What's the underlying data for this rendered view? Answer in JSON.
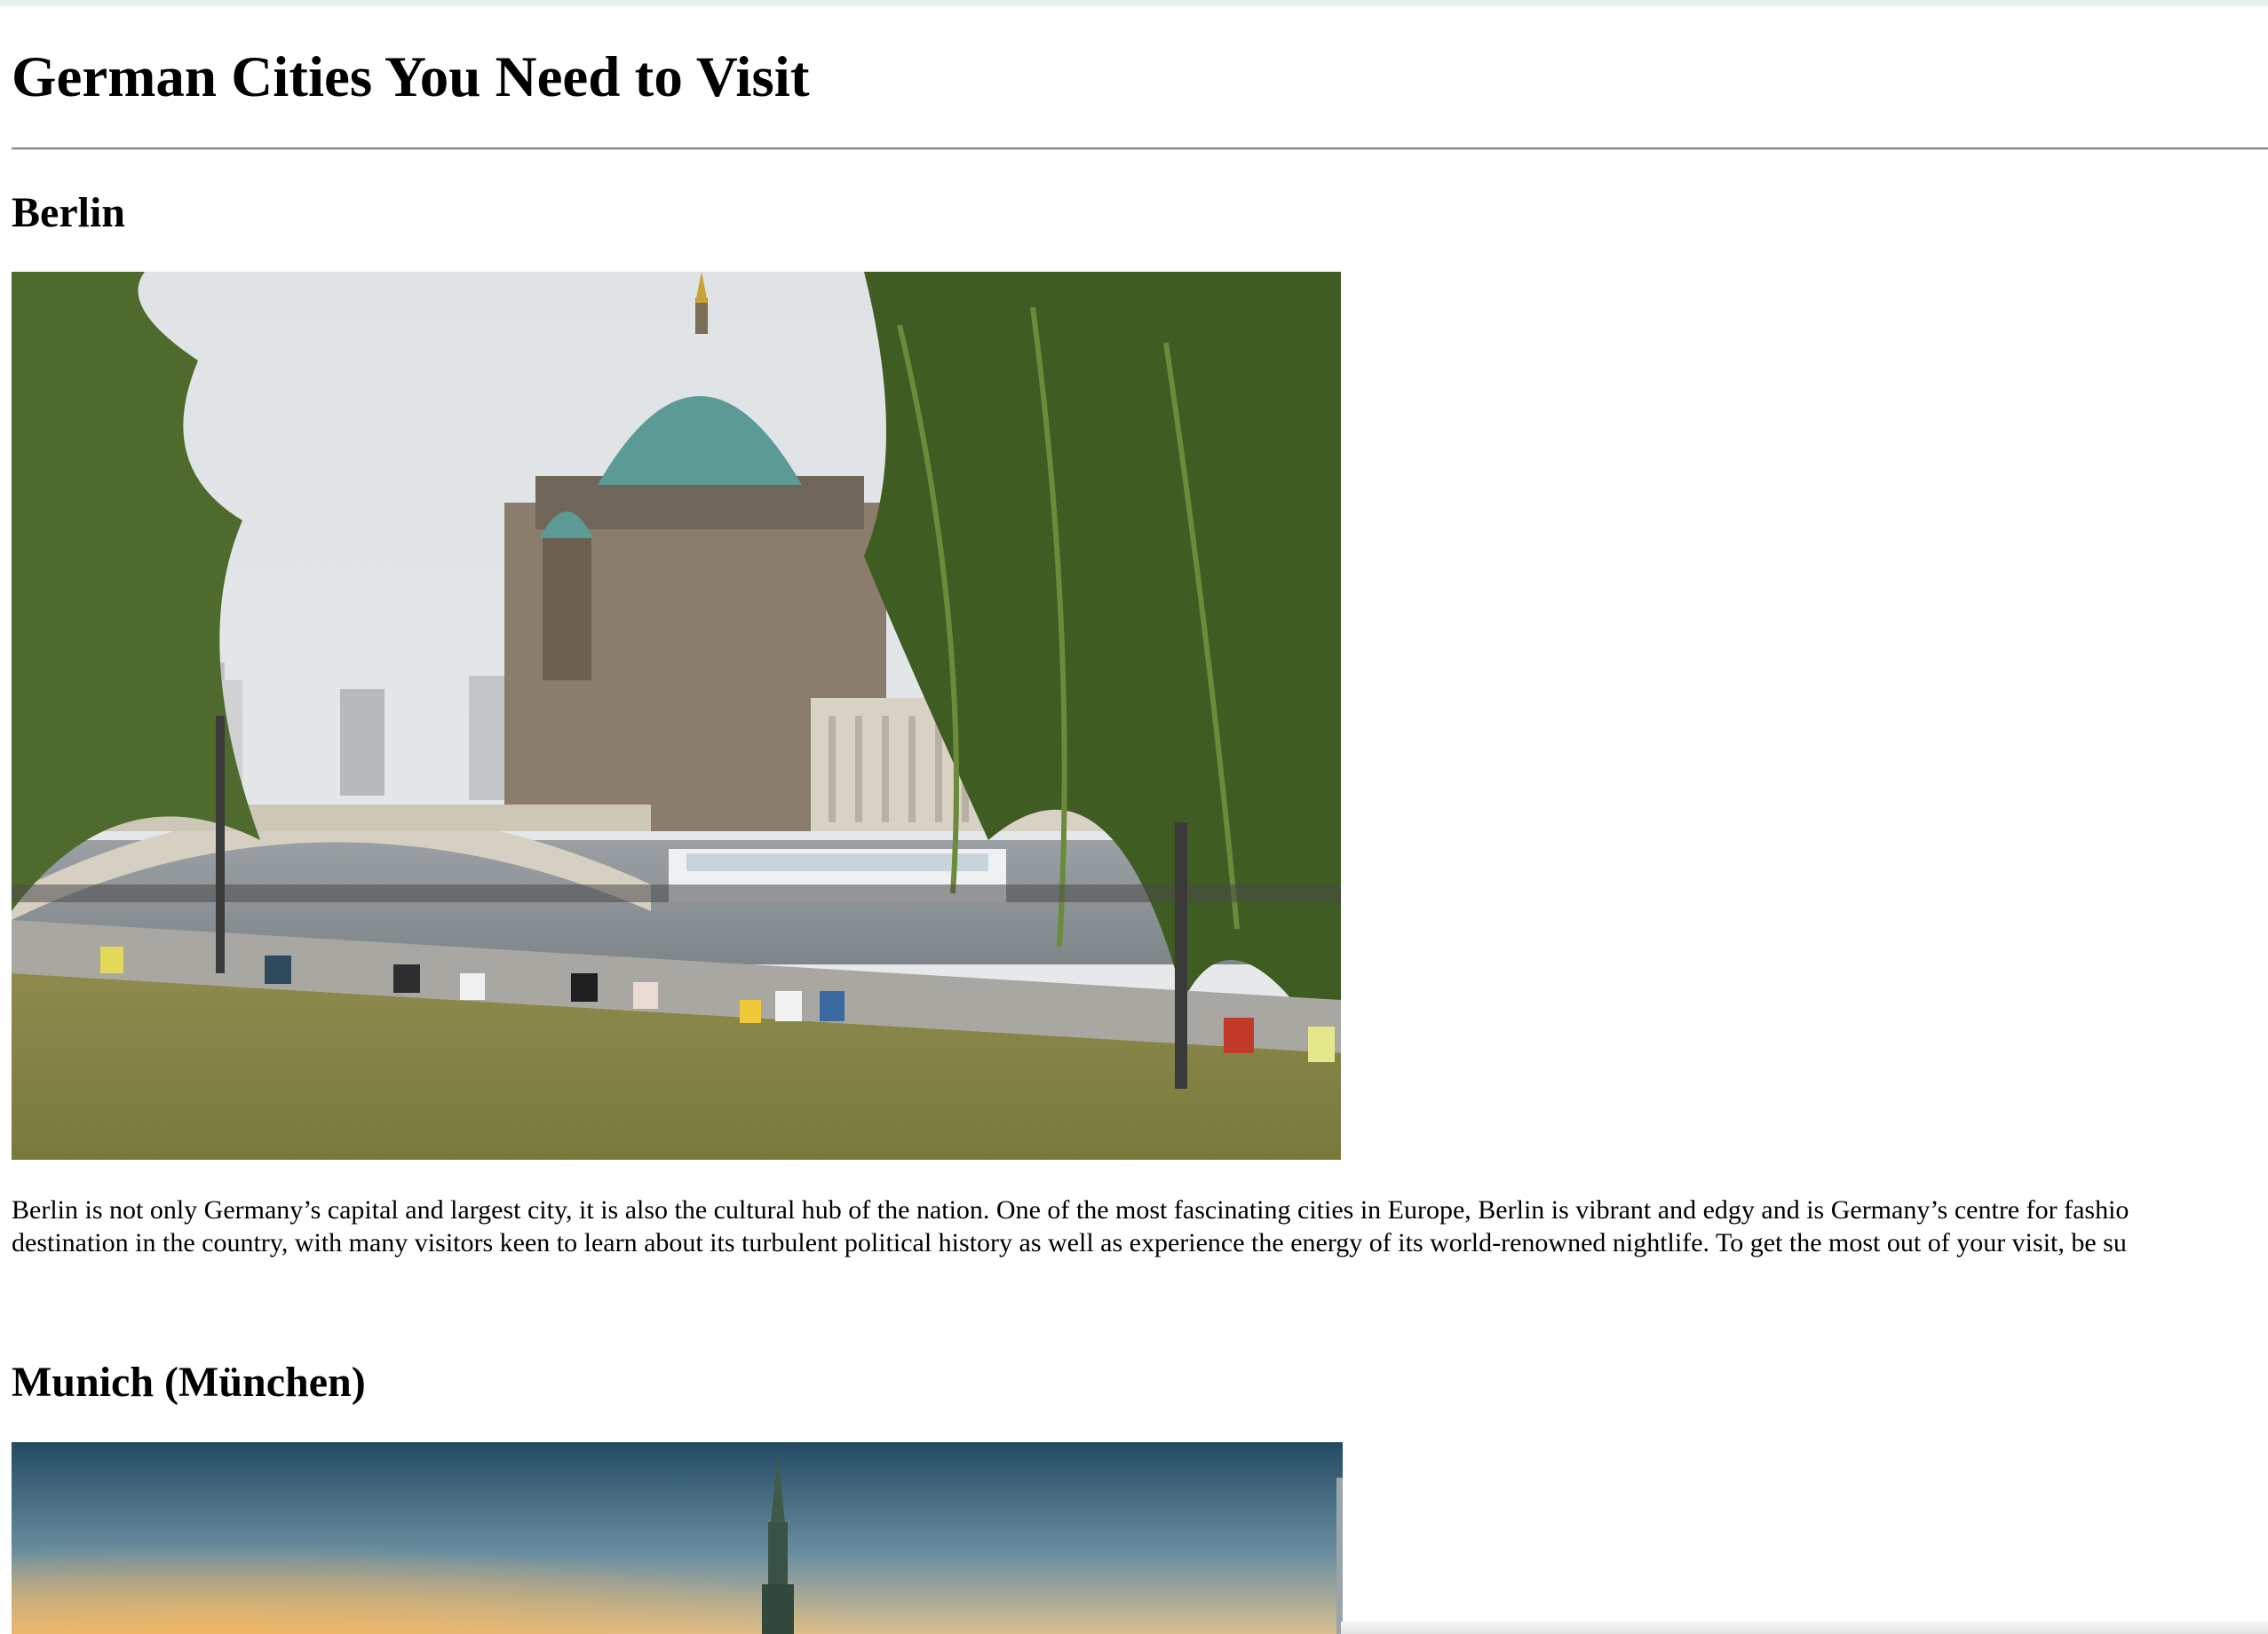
{
  "page": {
    "title": "German Cities You Need to Visit"
  },
  "sections": [
    {
      "heading": "Berlin",
      "image_description_icon": "berlin-cathedral-photo",
      "paragraph_lines": [
        "Berlin is not only Germany’s capital and largest city, it is also the cultural hub of the nation. One of the most fascinating cities in Europe, Berlin is vibrant and edgy and is Germany’s centre for fashio",
        "destination in the country, with many visitors keen to learn about its turbulent political history as well as experience the energy of its world-renowned nightlife. To get the most out of your visit, be su"
      ]
    },
    {
      "heading": "Munich (München)",
      "image_description_icon": "munich-skyline-photo"
    }
  ],
  "colors": {
    "text": "#000000",
    "background": "#ffffff",
    "rule": "#8c8c8c"
  }
}
